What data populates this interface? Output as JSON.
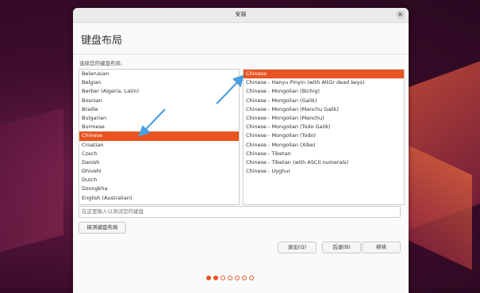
{
  "window": {
    "title": "安装",
    "heading": "键盘布局",
    "prompt": "选择您的键盘布局："
  },
  "layouts_left": {
    "items": [
      "Belarusian",
      "Belgian",
      "Berber (Algeria, Latin)",
      "Bosnian",
      "Braille",
      "Bulgarian",
      "Burmese",
      "Chinese",
      "Croatian",
      "Czech",
      "Danish",
      "Dhivehi",
      "Dutch",
      "Dzongkha",
      "English (Australian)"
    ],
    "selected": "Chinese"
  },
  "layouts_right": {
    "items": [
      "Chinese",
      "Chinese - Hanyu Pinyin (with AltGr dead keys)",
      "Chinese - Mongolian (Bichig)",
      "Chinese - Mongolian (Galik)",
      "Chinese - Mongolian (Manchu Galik)",
      "Chinese - Mongolian (Manchu)",
      "Chinese - Mongolian (Todo Galik)",
      "Chinese - Mongolian (Todo)",
      "Chinese - Mongolian (Xibe)",
      "Chinese - Tibetan",
      "Chinese - Tibetan (with ASCII numerals)",
      "Chinese - Uyghur"
    ],
    "selected": "Chinese"
  },
  "test_input": {
    "placeholder": "在这里输入以测试您的键盘"
  },
  "buttons": {
    "detect": "探测键盘布局",
    "quit": "退出(Q)",
    "back": "后退(B)",
    "continue": "继续"
  },
  "progress": {
    "total_steps": 7,
    "current_step": 2
  },
  "colors": {
    "accent": "#e95420",
    "annotation_arrow": "#4a9fe0"
  }
}
